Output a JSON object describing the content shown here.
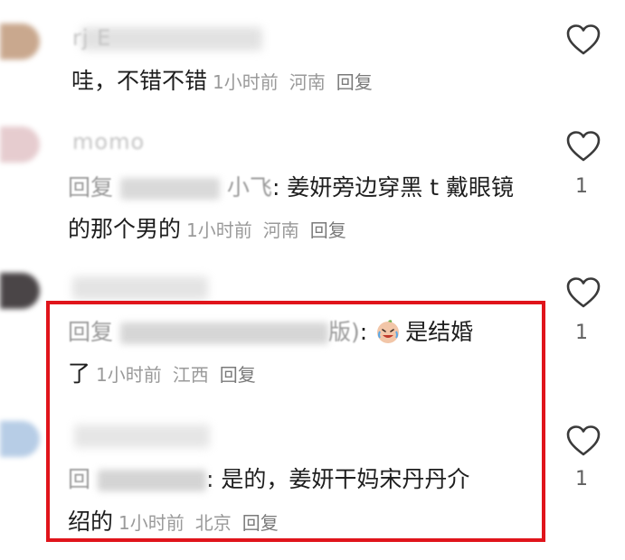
{
  "comments": [
    {
      "username": "rj E",
      "body": "哇，不错不错",
      "time": "1小时前",
      "location": "河南",
      "reply": "回复",
      "likes": ""
    },
    {
      "username": "momo",
      "reply_prefix": "回复",
      "reply_target": "小飞",
      "body_line1": ": 姜妍旁边穿黑 t 戴眼镜",
      "body_line2": "的那个男的",
      "time": "1小时前",
      "location": "河南",
      "reply": "回复",
      "likes": "1"
    },
    {
      "reply_prefix": "回复",
      "reply_target_suffix": "版)",
      "body_line1": "是结婚",
      "body_line2": "了",
      "emoji": "crying-laughing-emoji",
      "time": "1小时前",
      "location": "江西",
      "reply": "回复",
      "likes": "1"
    },
    {
      "reply_prefix": "回",
      "body_line1": ": 是的，姜妍干妈宋丹丹介",
      "body_line2": "绍的",
      "time": "1小时前",
      "location": "北京",
      "reply": "回复",
      "likes": "1"
    }
  ],
  "icons": {
    "like": "heart-outline-icon"
  },
  "colors": {
    "highlight": "#e0141b",
    "text": "#1e1e1e",
    "meta": "#9a9a9a"
  }
}
